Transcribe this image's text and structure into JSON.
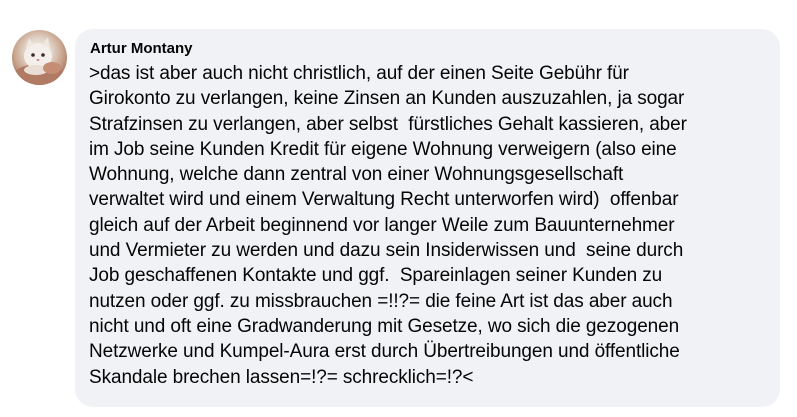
{
  "comment": {
    "author": "Artur Montany",
    "avatar_icon": "profile-photo-avatar",
    "bubble_color": "#f0f2f5",
    "text": ">das ist aber auch nicht christlich, auf der einen Seite Gebühr für\nGirokonto zu verlangen, keine Zinsen an Kunden auszuzahlen, ja sogar\nStrafzinsen zu verlangen, aber selbst  fürstliches Gehalt kassieren, aber\nim Job seine Kunden Kredit für eigene Wohnung verweigern (also eine\nWohnung, welche dann zentral von einer Wohnungsgesellschaft\nverwaltet wird und einem Verwaltung Recht unterworfen wird)  offenbar\ngleich auf der Arbeit beginnend vor langer Weile zum Bauunternehmer\nund Vermieter zu werden und dazu sein Insiderwissen und  seine durch\nJob geschaffenen Kontakte und ggf.  Spareinlagen seiner Kunden zu\nnutzen oder ggf. zu missbrauchen =!!?= die feine Art ist das aber auch\nnicht und oft eine Gradwanderung mit Gesetze, wo sich die gezogenen\nNetzwerke und Kumpel-Aura erst durch Übertreibungen und öffentliche\nSkandale brechen lassen=!?= schrecklich=!?<"
  }
}
